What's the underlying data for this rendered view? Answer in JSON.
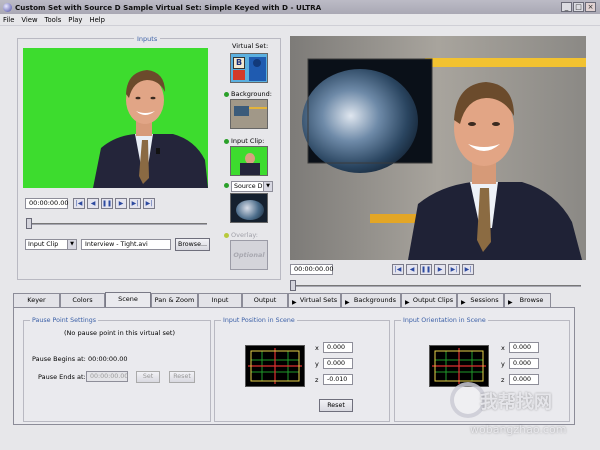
{
  "window": {
    "title": "Custom Set with Source D Sample   Virtual Set: Simple Keyed with D  - ULTRA",
    "controls": {
      "minimize": "_",
      "maximize": "□",
      "close": "×"
    }
  },
  "menu": [
    "File",
    "View",
    "Tools",
    "Play",
    "Help"
  ],
  "inputs": {
    "section_title": "Inputs",
    "timecode": "00:00:00.00",
    "source_select": "Input Clip",
    "clip_field": "Interview - Tight.avi",
    "browse_label": "Browse..."
  },
  "side": {
    "virtual_set_label": "Virtual Set:",
    "background_label": "Background:",
    "input_clip_label": "Input Clip:",
    "source_select": "Source D",
    "overlay_label": "Overlay:",
    "optional_label": "Optional",
    "vs_logo_letter": "B"
  },
  "transport_icons": [
    "skip-start",
    "step-back",
    "pause",
    "play",
    "step-forward",
    "skip-end"
  ],
  "transport_glyphs": [
    "|◀",
    "◀",
    "❚❚",
    "▶",
    "▶|",
    "▶|"
  ],
  "preview": {
    "timecode": "00:00:00.00"
  },
  "tabs": [
    {
      "label": "Keyer",
      "icon": false
    },
    {
      "label": "Colors",
      "icon": false
    },
    {
      "label": "Scene",
      "icon": false,
      "active": true
    },
    {
      "label": "Pan & Zoom",
      "icon": false
    },
    {
      "label": "Input",
      "icon": false
    },
    {
      "label": "Output",
      "icon": false
    },
    {
      "label": "Virtual Sets",
      "icon": true
    },
    {
      "label": "Backgrounds",
      "icon": true
    },
    {
      "label": "Output Clips",
      "icon": true
    },
    {
      "label": "Sessions",
      "icon": true
    },
    {
      "label": "Browse",
      "icon": true
    }
  ],
  "pause_points": {
    "title": "Pause Point Settings",
    "message": "(No pause point in this virtual set)",
    "begins_label": "Pause Begins at:",
    "begins_value": "00:00:00.00",
    "ends_label": "Pause Ends at:",
    "ends_value": "00:00:00.00",
    "set_label": "Set",
    "reset_label": "Reset"
  },
  "position": {
    "title": "Input Position in Scene",
    "x_label": "x",
    "x": "0.000",
    "y_label": "y",
    "y": "0.000",
    "z_label": "z",
    "z": "-0.010",
    "reset_label": "Reset"
  },
  "orientation": {
    "title": "Input Orientation in Scene",
    "x_label": "x",
    "x": "0.000",
    "y_label": "y",
    "y": "0.000",
    "z_label": "z",
    "z": "0.000"
  },
  "watermark": {
    "brand": "我帮找网",
    "url": "wobangzhao.com"
  }
}
